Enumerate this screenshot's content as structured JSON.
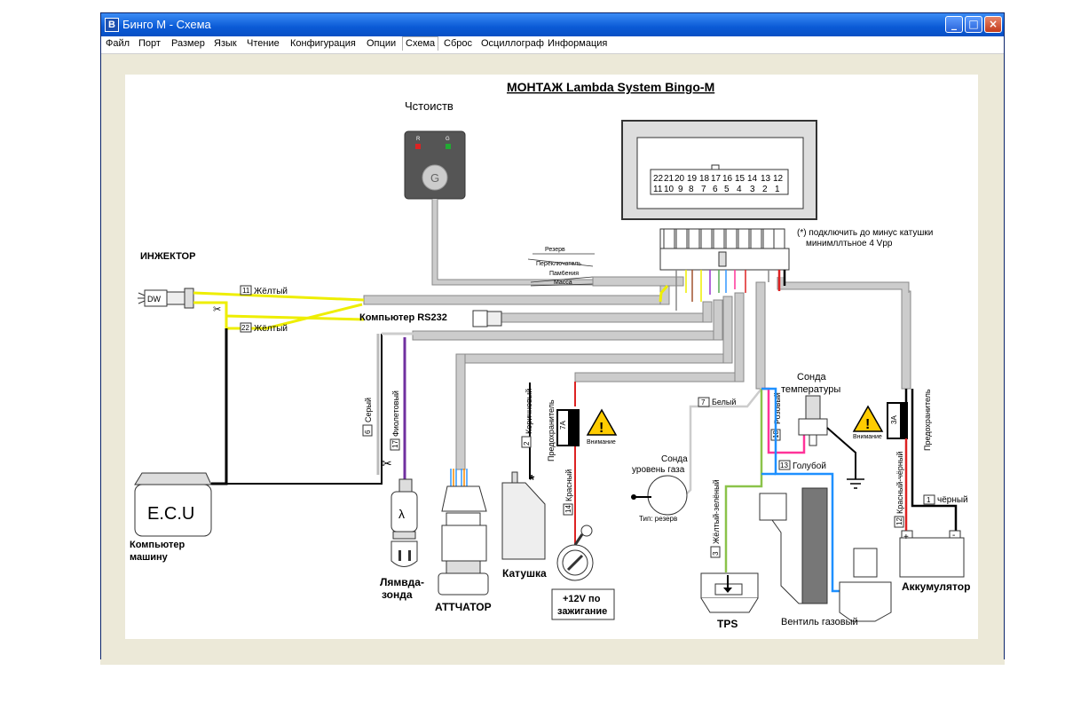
{
  "window": {
    "title": "Бинго М - Схема",
    "icon_letter": "B"
  },
  "menu": [
    "Файл",
    "Порт",
    "Размер",
    "Язык",
    "Чтение",
    "Конфигурация",
    "Опции",
    "Схема",
    "Сброс",
    "Осциллограф",
    "Информация"
  ],
  "diagram": {
    "title": "МОНТАЖ Lambda System  Bingo-M",
    "switch_label": "Чстоиств",
    "switch_led_r": "R",
    "switch_led_g": "G",
    "switch_button": "G",
    "connector_top_row": [
      "22",
      "21",
      "20",
      "19",
      "18",
      "17",
      "16",
      "15",
      "14",
      "13",
      "12"
    ],
    "connector_bottom_row": [
      "11",
      "10",
      "9",
      "8",
      "7",
      "6",
      "5",
      "4",
      "3",
      "2",
      "1"
    ],
    "note_line1": "(*) подключить до минус катушки",
    "note_line2": "минимллтьное 4 Vpp",
    "branch_labels": [
      "Резерв",
      "Переключатель",
      "Пам6ения",
      "Масса"
    ],
    "injector_label": "ИНЖЕКТОР",
    "injector_glyph": "DW",
    "wire_11": {
      "num": "11",
      "name": "Жёлтый"
    },
    "wire_22": {
      "num": "22",
      "name": "Жёлтый"
    },
    "rs232_label": "Компьютер  RS232",
    "wire_6": {
      "num": "6",
      "name": "Серый"
    },
    "wire_17": {
      "num": "17",
      "name": "Фиолетовый"
    },
    "wire_2": {
      "num": "2",
      "name": "Коричневый"
    },
    "wire_14": {
      "num": "14",
      "name": "Красный"
    },
    "fuse_7a_label": "Предохранитель",
    "fuse_7a_value": "7A",
    "warning_text": "Внимание",
    "wire_7": {
      "num": "7",
      "name": "Белый"
    },
    "temp_sensor_label_1": "Сонда",
    "temp_sensor_label_2": "температуры",
    "wire_18": {
      "num": "18",
      "name": "Розовый"
    },
    "wire_13": {
      "num": "13",
      "name": "Голубой"
    },
    "fuse_3a_value": "3A",
    "fuse_3a_label": "Предохранитель",
    "wire_12": {
      "num": "12",
      "name": "Красный-чёрный"
    },
    "wire_1": {
      "num": "1",
      "name": "чёрный"
    },
    "gas_sensor_label_1": "Сонда",
    "gas_sensor_label_2": "уровень газа",
    "reserve_type": "Тип: резерв",
    "wire_3": {
      "num": "3",
      "name": "Жёлтый-зелёный"
    },
    "ecu_text": "E.C.U",
    "ecu_label_1": "Компьютер",
    "ecu_label_2": "машину",
    "lambda_glyph": "λ",
    "lambda_label_1": "Лямвда-",
    "lambda_label_2": "зонда",
    "actuator_label": "АТТЧАТОР",
    "coil_label": "Катушка",
    "star_mark": "*",
    "ignition_label_1": "+12V по",
    "ignition_label_2": "зажигание",
    "tps_label": "TPS",
    "valve_label": "Вентиль газовый",
    "battery_label": "Аккумулятор",
    "battery_plus": "+",
    "battery_minus": "-"
  }
}
